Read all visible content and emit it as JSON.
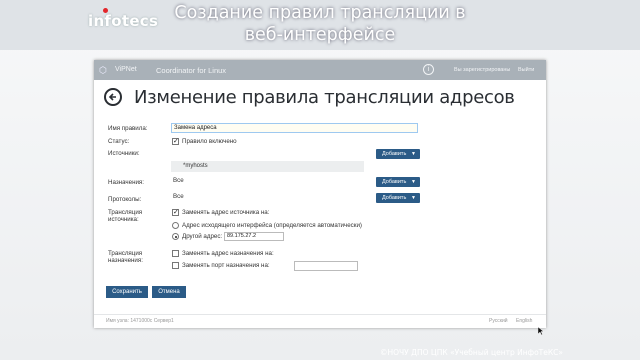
{
  "slide": {
    "logo": "infotecs",
    "title_line1": "Создание правил трансляции в",
    "title_line2": "веб-интерфейсе",
    "copyright": "©НОЧУ ДПО ЦПК «Учебный центр ИнфоТеКС»"
  },
  "appbar": {
    "product": "ViPNet",
    "app_name": "Coordinator for Linux",
    "info_icon": "i",
    "user": "Вы зарегистрированы",
    "exit": "Выйти"
  },
  "page": {
    "title": "Изменение правила трансляции адресов"
  },
  "form": {
    "name_label": "Имя правила:",
    "name_value": "Замена адреса",
    "status_label": "Статус:",
    "status_checkbox": "Правило включено",
    "status_checked": true,
    "sources_label": "Источники:",
    "sources_item": "*myhosts",
    "add_button": "Добавить",
    "destinations_label": "Назначения:",
    "destinations_value": "Все",
    "protocols_label": "Протоколы:",
    "protocols_value": "Все",
    "src_translation_label_1": "Трансляция",
    "src_translation_label_2": "источника:",
    "replace_src_checkbox": "Заменять адрес источника на:",
    "replace_src_checked": true,
    "radio_auto": "Адрес исходящего интерфейса (определяется автоматически)",
    "radio_other": "Другой адрес:",
    "other_address": "89.175.27.2",
    "dst_translation_label_1": "Трансляция",
    "dst_translation_label_2": "назначения:",
    "replace_dst_checkbox": "Заменять адрес назначения на:",
    "replace_port_checkbox": "Заменять порт назначения на:",
    "save_button": "Сохранить",
    "cancel_button": "Отмена"
  },
  "footer": {
    "left": "Имя узла: 1471000c Сервер1",
    "lang_ru": "Русский",
    "lang_en": "English"
  }
}
